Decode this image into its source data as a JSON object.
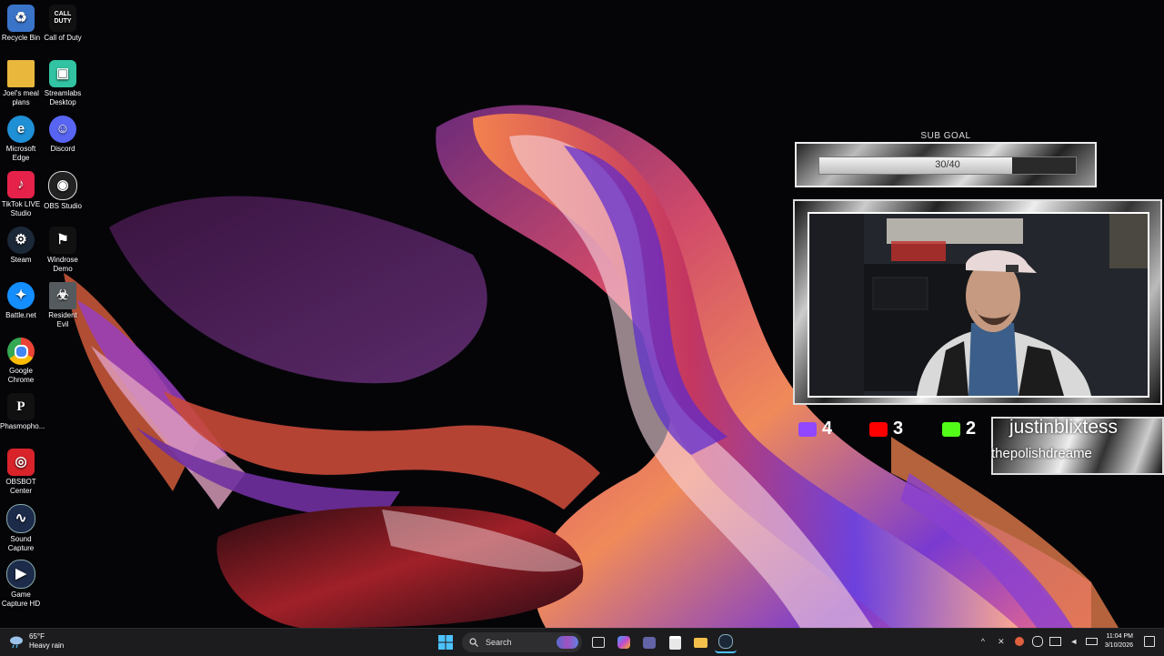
{
  "desktop": {
    "icons": [
      {
        "label": "Recycle Bin",
        "icon": "recycle-bin-icon",
        "color": "#3a74c9"
      },
      {
        "label": "Call of Duty",
        "icon": "call-of-duty-icon",
        "color": "#111111",
        "glyph": "CALL DUTY"
      },
      {
        "label": "Joel's meal plans",
        "icon": "folder-icon",
        "color": "#e8b73c"
      },
      {
        "label": "Streamlabs Desktop",
        "icon": "streamlabs-icon",
        "color": "#31c3a2"
      },
      {
        "label": "Microsoft Edge",
        "icon": "edge-icon",
        "color": "#1f8fd6"
      },
      {
        "label": "Discord",
        "icon": "discord-icon",
        "color": "#5865f2"
      },
      {
        "label": "TikTok LIVE Studio",
        "icon": "tiktok-icon",
        "color": "#e6224a"
      },
      {
        "label": "OBS Studio",
        "icon": "obs-icon",
        "color": "#222222"
      },
      {
        "label": "Steam",
        "icon": "steam-icon",
        "color": "#1b2838"
      },
      {
        "label": "Windrose Demo",
        "icon": "windrose-icon",
        "color": "#111111"
      },
      {
        "label": "Battle.net",
        "icon": "battlenet-icon",
        "color": "#148eff"
      },
      {
        "label": "Resident Evil",
        "icon": "resident-evil-icon",
        "color": "#555a5e"
      },
      {
        "label": "Google Chrome",
        "icon": "chrome-icon",
        "color": "#34a853"
      },
      {
        "label": "Phasmopho...",
        "icon": "phasmophobia-icon",
        "color": "#111111"
      },
      {
        "label": "OBSBOT Center",
        "icon": "obsbot-icon",
        "color": "#d8232a"
      },
      {
        "label": "Sound Capture",
        "icon": "sound-capture-icon",
        "color": "#1d2b4a"
      },
      {
        "label": "Game Capture HD",
        "icon": "game-capture-icon",
        "color": "#1d2b4a"
      }
    ]
  },
  "overlay": {
    "sub_goal_title": "SUB GOAL",
    "sub_goal_text": "30/40",
    "sub_goal_current": 30,
    "sub_goal_target": 40,
    "socials": [
      {
        "platform": "twitch-icon",
        "count": "4",
        "color": "#9146ff"
      },
      {
        "platform": "youtube-icon",
        "count": "3",
        "color": "#ff0000"
      },
      {
        "platform": "kick-icon",
        "count": "2",
        "color": "#53fc18"
      }
    ],
    "username_primary": "justinblixtess",
    "username_secondary": "thepolishdreame"
  },
  "taskbar": {
    "weather_temp": "65°F",
    "weather_desc": "Heavy rain",
    "search_placeholder": "Search",
    "time": "11:04 PM",
    "date": "3/10/2026",
    "accent": "#4cc2ff"
  }
}
